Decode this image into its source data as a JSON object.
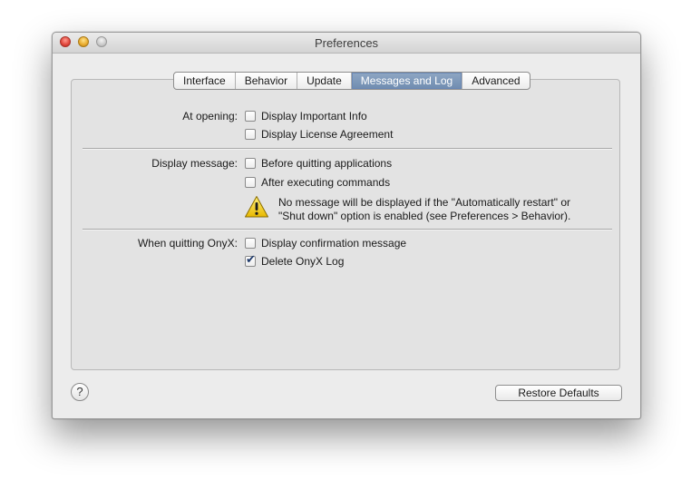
{
  "window": {
    "title": "Preferences"
  },
  "tabs": [
    {
      "label": "Interface",
      "selected": false
    },
    {
      "label": "Behavior",
      "selected": false
    },
    {
      "label": "Update",
      "selected": false
    },
    {
      "label": "Messages and Log",
      "selected": true
    },
    {
      "label": "Advanced",
      "selected": false
    }
  ],
  "at_opening": {
    "label": "At opening:",
    "options": [
      {
        "label": "Display Important Info",
        "checked": false
      },
      {
        "label": "Display License Agreement",
        "checked": false
      }
    ]
  },
  "display_message": {
    "label": "Display message:",
    "options": [
      {
        "label": "Before quitting applications",
        "checked": false
      },
      {
        "label": "After executing commands",
        "checked": false
      }
    ],
    "warning_line1": "No message will be displayed if the \"Automatically restart\" or",
    "warning_line2": "\"Shut down\" option is enabled (see Preferences > Behavior)."
  },
  "when_quitting": {
    "label": "When quitting OnyX:",
    "options": [
      {
        "label": "Display confirmation message",
        "checked": false
      },
      {
        "label": "Delete OnyX Log",
        "checked": true
      }
    ]
  },
  "buttons": {
    "help_symbol": "?",
    "restore_defaults": "Restore Defaults"
  },
  "colors": {
    "tab_selected": "#7b96b9",
    "checkmark": "#1f3a6b",
    "warning_yellow": "#f5d322"
  },
  "icons": {
    "warning": "warning-triangle-icon",
    "checkmark": "checkmark-icon"
  }
}
